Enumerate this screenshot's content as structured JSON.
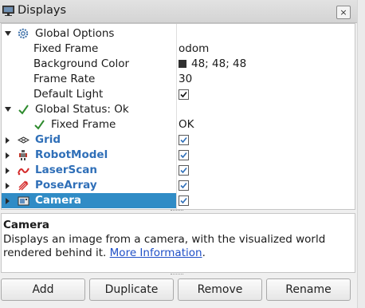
{
  "window": {
    "title": "Displays",
    "close_glyph": "×"
  },
  "tree": {
    "global_options": {
      "label": "Global Options",
      "icon": "gear-icon",
      "properties": [
        {
          "name": "Fixed Frame",
          "value": "odom"
        },
        {
          "name": "Background Color",
          "value": "48; 48; 48",
          "swatch_color": "#303030"
        },
        {
          "name": "Frame Rate",
          "value": "30"
        },
        {
          "name": "Default Light",
          "checked": true
        }
      ]
    },
    "global_status": {
      "label": "Global Status: Ok",
      "icon": "checkmark-icon",
      "children": [
        {
          "name": "Fixed Frame",
          "value": "OK"
        }
      ]
    },
    "displays": [
      {
        "label": "Grid",
        "icon": "grid-icon",
        "checked": true
      },
      {
        "label": "RobotModel",
        "icon": "robot-model-icon",
        "checked": true
      },
      {
        "label": "LaserScan",
        "icon": "laser-scan-icon",
        "checked": true
      },
      {
        "label": "PoseArray",
        "icon": "pose-array-icon",
        "checked": true
      },
      {
        "label": "Camera",
        "icon": "camera-icon",
        "checked": true,
        "selected": true
      }
    ]
  },
  "description": {
    "title": "Camera",
    "text": "Displays an image from a camera, with the visualized world rendered behind it.",
    "link_text": "More Information",
    "suffix": "."
  },
  "buttons": {
    "add": "Add",
    "duplicate": "Duplicate",
    "remove": "Remove",
    "rename": "Rename"
  },
  "colors": {
    "selection": "#308cc6",
    "display_label": "#2f6fb8",
    "link": "#1f4fc7"
  }
}
